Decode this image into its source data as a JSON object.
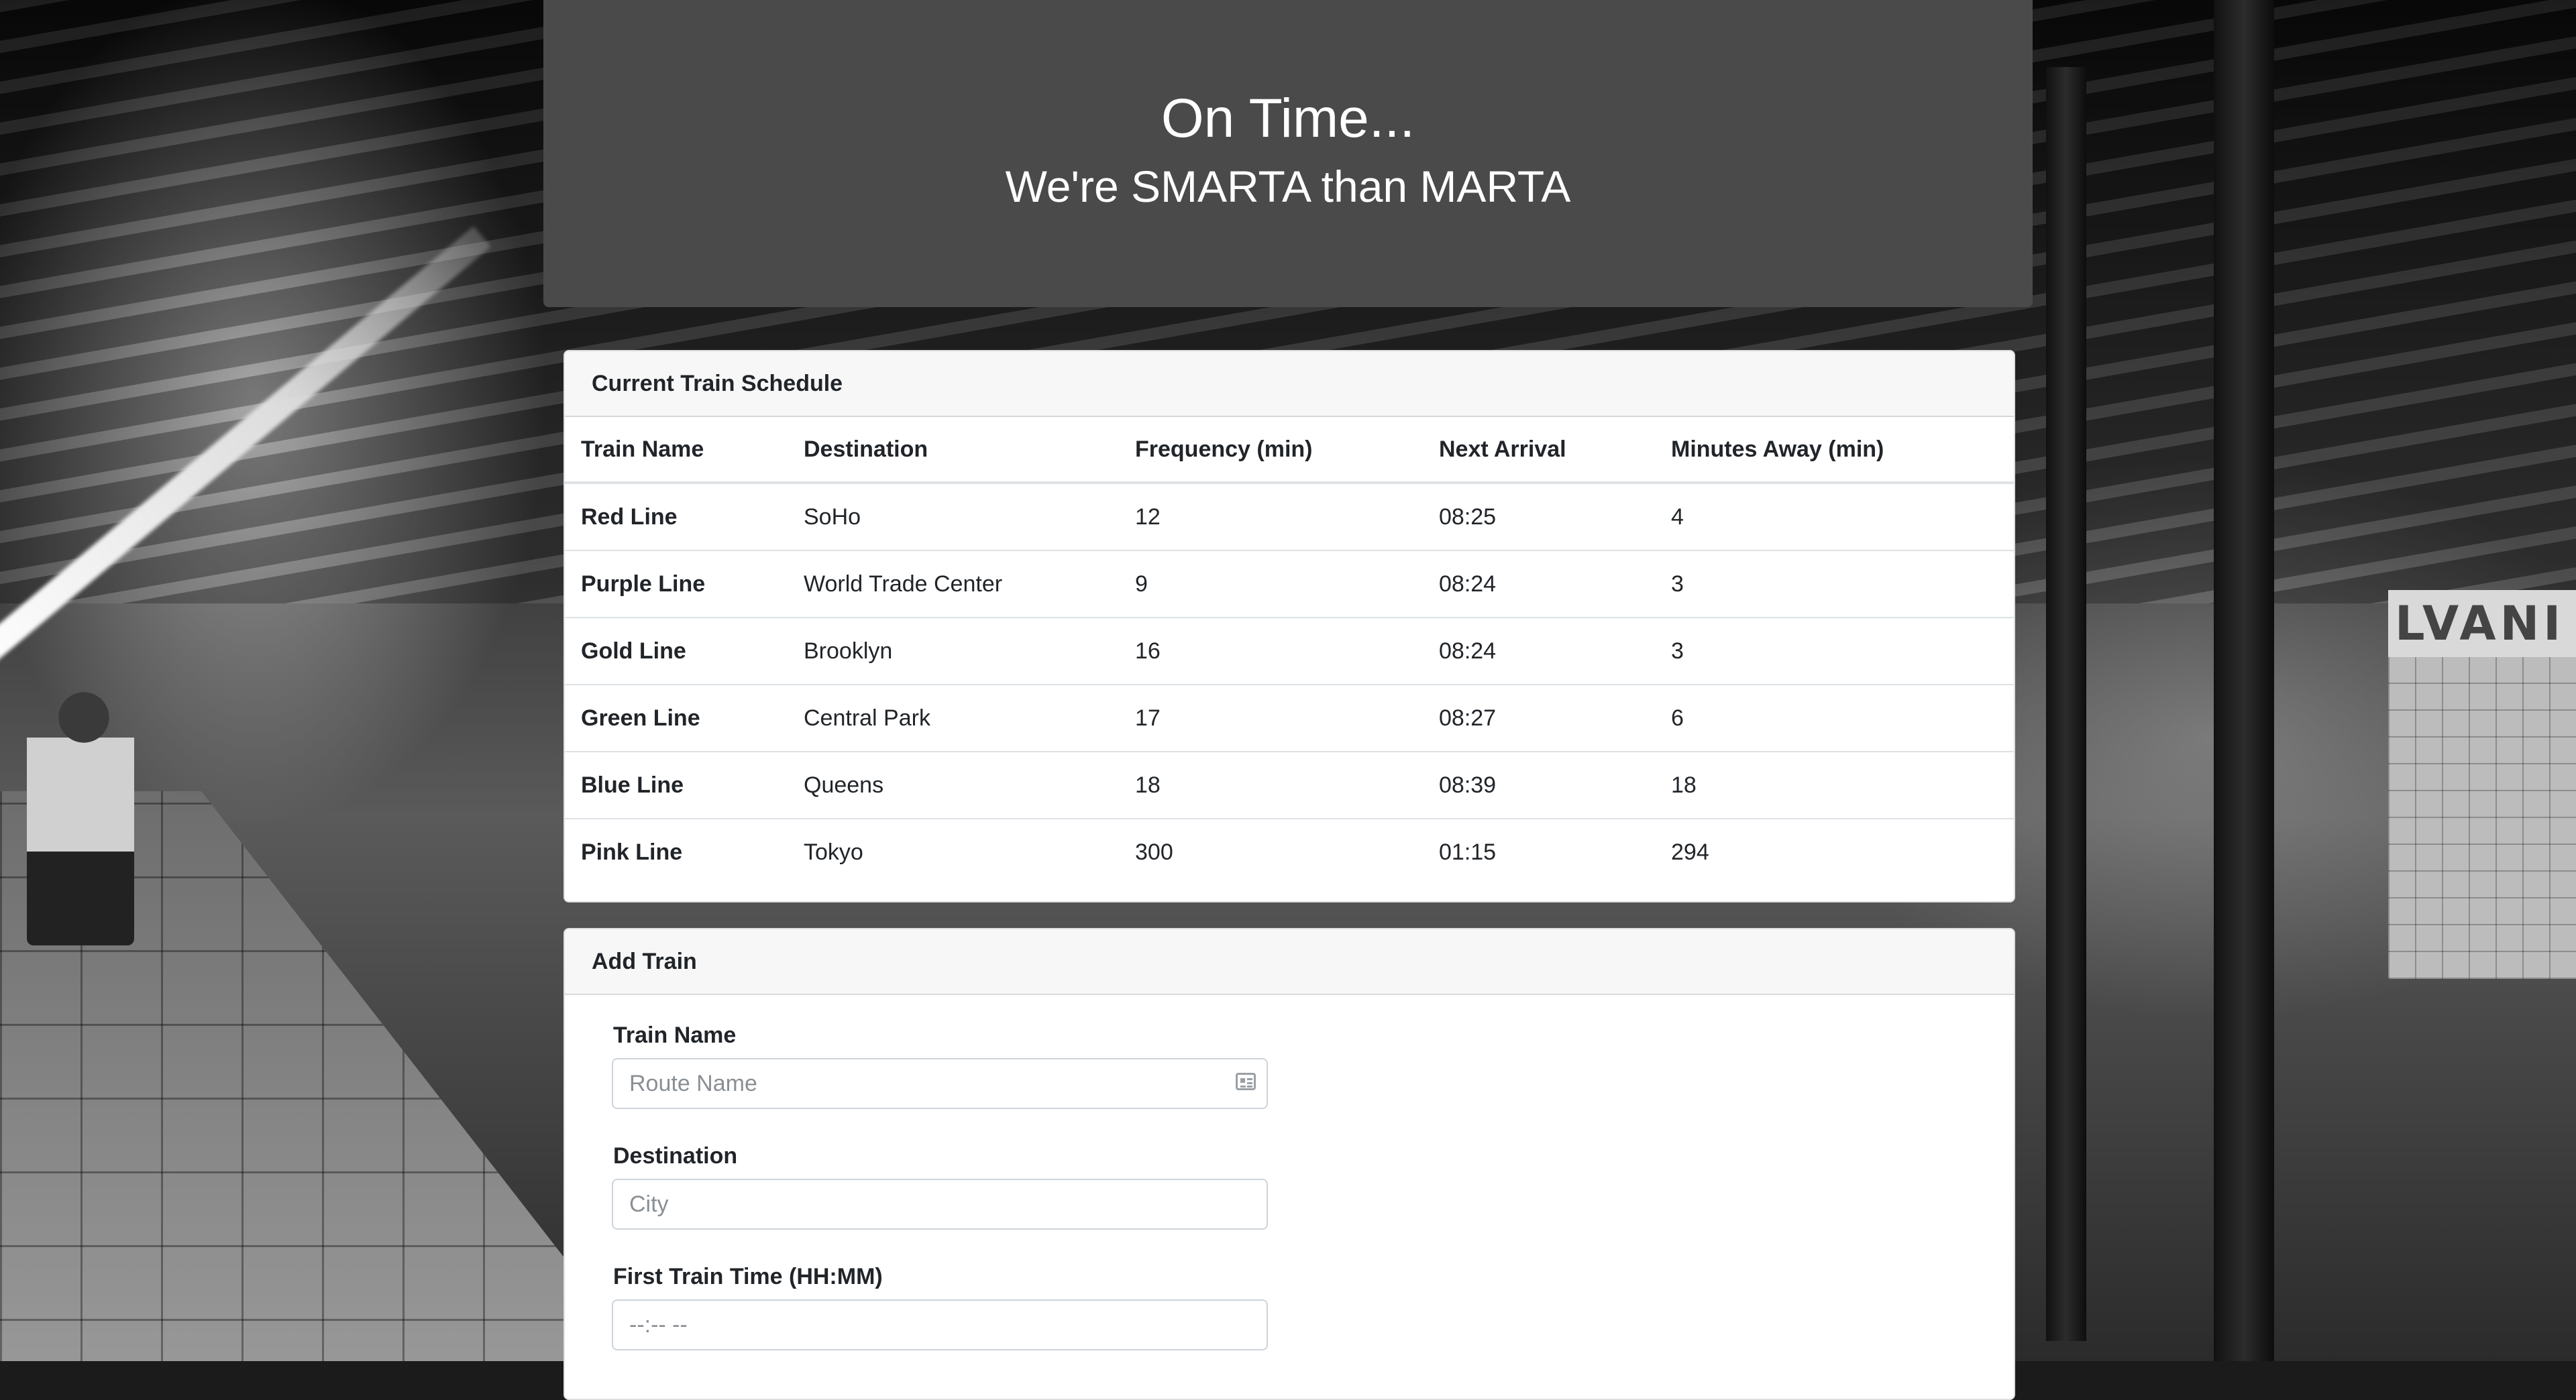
{
  "header": {
    "title": "On Time...",
    "subtitle": "We're SMARTA than MARTA"
  },
  "schedule": {
    "heading": "Current Train Schedule",
    "columns": [
      "Train Name",
      "Destination",
      "Frequency (min)",
      "Next Arrival",
      "Minutes Away (min)"
    ],
    "rows": [
      [
        "Red Line",
        "SoHo",
        "12",
        "08:25",
        "4"
      ],
      [
        "Purple Line",
        "World Trade Center",
        "9",
        "08:24",
        "3"
      ],
      [
        "Gold Line",
        "Brooklyn",
        "16",
        "08:24",
        "3"
      ],
      [
        "Green Line",
        "Central Park",
        "17",
        "08:27",
        "6"
      ],
      [
        "Blue Line",
        "Queens",
        "18",
        "08:39",
        "18"
      ],
      [
        "Pink Line",
        "Tokyo",
        "300",
        "01:15",
        "294"
      ]
    ]
  },
  "add_train": {
    "heading": "Add Train",
    "train_name": {
      "label": "Train Name",
      "placeholder": "Route Name",
      "icon": "contact-card-icon"
    },
    "destination": {
      "label": "Destination",
      "placeholder": "City"
    },
    "first_time": {
      "label": "First Train Time (HH:MM)",
      "placeholder": "--:-- --"
    }
  },
  "background": {
    "sign_text": "LVANI"
  },
  "colors": {
    "jumbotron": "#4b4a4b",
    "card_header": "#f7f7f7"
  }
}
